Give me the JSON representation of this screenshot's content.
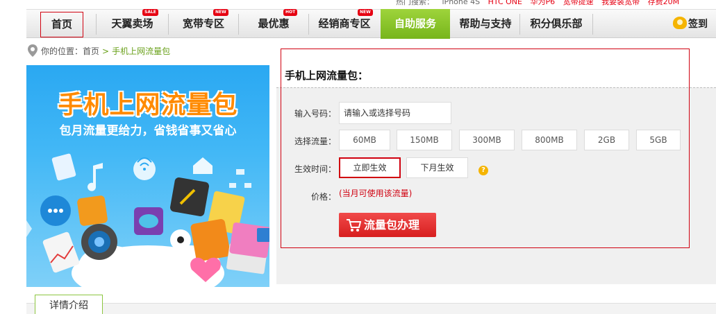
{
  "hot_search": {
    "label": "热门搜索：",
    "keywords": [
      "iPhone 4S",
      "HTC ONE",
      "华为P6",
      "宽带提速",
      "我要装宽带",
      "存费20M"
    ]
  },
  "nav": {
    "items": [
      {
        "label": "首页",
        "badge": ""
      },
      {
        "label": "天翼卖场",
        "badge": "SALE"
      },
      {
        "label": "宽带专区",
        "badge": "NEW"
      },
      {
        "label": "最优惠",
        "badge": "HOT"
      },
      {
        "label": "经销商专区",
        "badge": "NEW"
      },
      {
        "label": "自助服务",
        "badge": ""
      },
      {
        "label": "帮助与支持",
        "badge": ""
      },
      {
        "label": "积分俱乐部",
        "badge": ""
      }
    ],
    "checkin": "签到"
  },
  "breadcrumb": {
    "prefix": "你的位置：",
    "home": "首页",
    "separator": ">",
    "current": "手机上网流量包"
  },
  "banner": {
    "title": "手机上网流量包",
    "subtitle": "包月流量更给力，省钱省事又省心"
  },
  "form": {
    "title": "手机上网流量包：",
    "phone_label": "输入号码：",
    "phone_value": "请输入或选择号码",
    "traffic_label": "选择流量：",
    "traffic_options": [
      "60MB",
      "150MB",
      "300MB",
      "800MB",
      "2GB",
      "5GB"
    ],
    "effective_label": "生效时间：",
    "effective_options": [
      "立即生效",
      "下月生效"
    ],
    "selected_effective": "立即生效",
    "help_symbol": "?",
    "price_label": "价格：",
    "price_note": "(当月可使用该流量)",
    "submit_label": "流量包办理"
  },
  "tabs": {
    "detail": "详情介绍"
  },
  "colors": {
    "brand_red": "#d0000f",
    "active_green": "#77b51b",
    "submit_red": "#d71f1f",
    "crumb_green": "#6aa11b"
  }
}
